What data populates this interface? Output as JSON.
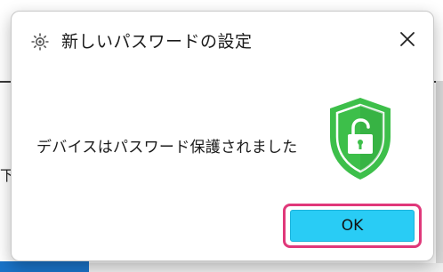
{
  "dialog": {
    "title": "新しいパスワードの設定",
    "message": "デバイスはパスワード保護されました",
    "close_icon": "close-icon",
    "app_icon": "settings-gear-icon",
    "shield_icon": "shield-unlocked-padlock-icon",
    "ok_label": "OK",
    "colors": {
      "ok_button": "#29ccf5",
      "highlight_border": "#e0387a",
      "shield_green": "#3dbf4a",
      "shield_dark_green": "#2e9e3a"
    }
  },
  "background": {
    "edge_glyph": "下"
  }
}
